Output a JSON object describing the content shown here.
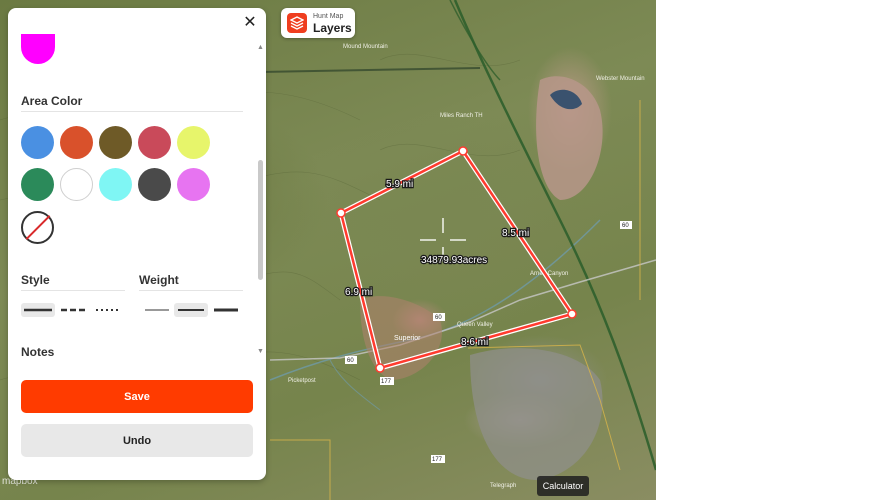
{
  "panel": {
    "close_glyph": "✕",
    "area_color_title": "Area Color",
    "area_colors": [
      {
        "name": "blue",
        "hex": "#4a90e2"
      },
      {
        "name": "orange",
        "hex": "#d9512b"
      },
      {
        "name": "olive",
        "hex": "#6e5a27"
      },
      {
        "name": "rose",
        "hex": "#c94a5a"
      },
      {
        "name": "yellow-green",
        "hex": "#e7f56b"
      },
      {
        "name": "green",
        "hex": "#2b8a5a"
      },
      {
        "name": "white",
        "hex": "#ffffff"
      },
      {
        "name": "cyan",
        "hex": "#7ff6f4"
      },
      {
        "name": "dark-gray",
        "hex": "#4a4a4a"
      },
      {
        "name": "violet",
        "hex": "#e774f1"
      },
      {
        "name": "none",
        "hex": ""
      }
    ],
    "previous_color": "#ff00ff",
    "style_title": "Style",
    "weight_title": "Weight",
    "notes_title": "Notes",
    "save_label": "Save",
    "undo_label": "Undo"
  },
  "layers_button": {
    "sub": "Hunt Map",
    "main": "Layers"
  },
  "calculator_label": "Calculator",
  "map": {
    "attribution": "mapbox",
    "polygon_color": "#ff3b2f",
    "segment_labels": [
      "5.9 mi",
      "8.5 mi",
      "8.6 mi",
      "6.9 mi"
    ],
    "area_label": "34879.93acres",
    "place_labels": [
      "Mound Mountain",
      "Miles Ranch TH",
      "Webster Mountain",
      "Superior",
      "Queen Valley",
      "Telegraph",
      "Picketpost",
      "Arnett Canyon"
    ],
    "road_labels": [
      "60",
      "60",
      "60",
      "177",
      "177"
    ]
  }
}
